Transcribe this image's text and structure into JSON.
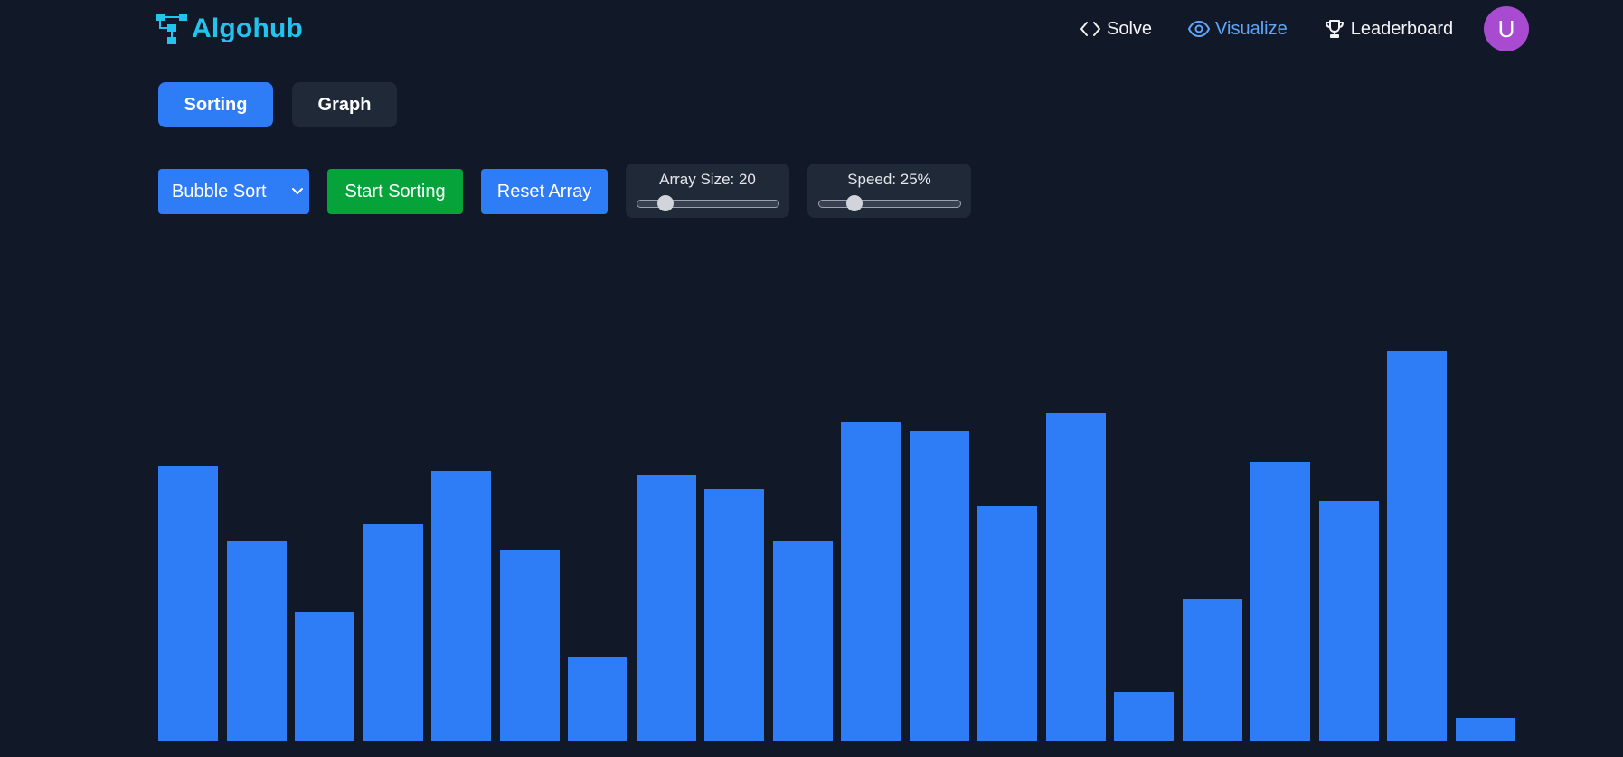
{
  "brand": {
    "name": "Algohub",
    "icon": "flowchart-icon",
    "color": "#22c3ee"
  },
  "nav": {
    "items": [
      {
        "label": "Solve",
        "icon": "code-icon",
        "active": false
      },
      {
        "label": "Visualize",
        "icon": "eye-icon",
        "active": true
      },
      {
        "label": "Leaderboard",
        "icon": "trophy-icon",
        "active": false
      }
    ],
    "avatar_initial": "U",
    "avatar_color": "#a94bd0"
  },
  "tabs": [
    {
      "label": "Sorting",
      "active": true
    },
    {
      "label": "Graph",
      "active": false
    }
  ],
  "controls": {
    "algorithm_select": {
      "value": "Bubble Sort"
    },
    "start_label": "Start Sorting",
    "reset_label": "Reset Array",
    "array_size": {
      "label": "Array Size: 20",
      "fraction": 0.2
    },
    "speed": {
      "label": "Speed: 25%",
      "fraction": 0.25
    }
  },
  "colors": {
    "background": "#111827",
    "accent": "#2e7cf6",
    "start_button": "#05a33a",
    "card": "#1f2937"
  },
  "chart_data": {
    "type": "bar",
    "values": [
      62,
      45,
      29,
      49,
      61,
      43,
      19,
      60,
      57,
      45,
      72,
      70,
      53,
      74,
      11,
      32,
      63,
      54,
      88,
      5
    ]
  }
}
